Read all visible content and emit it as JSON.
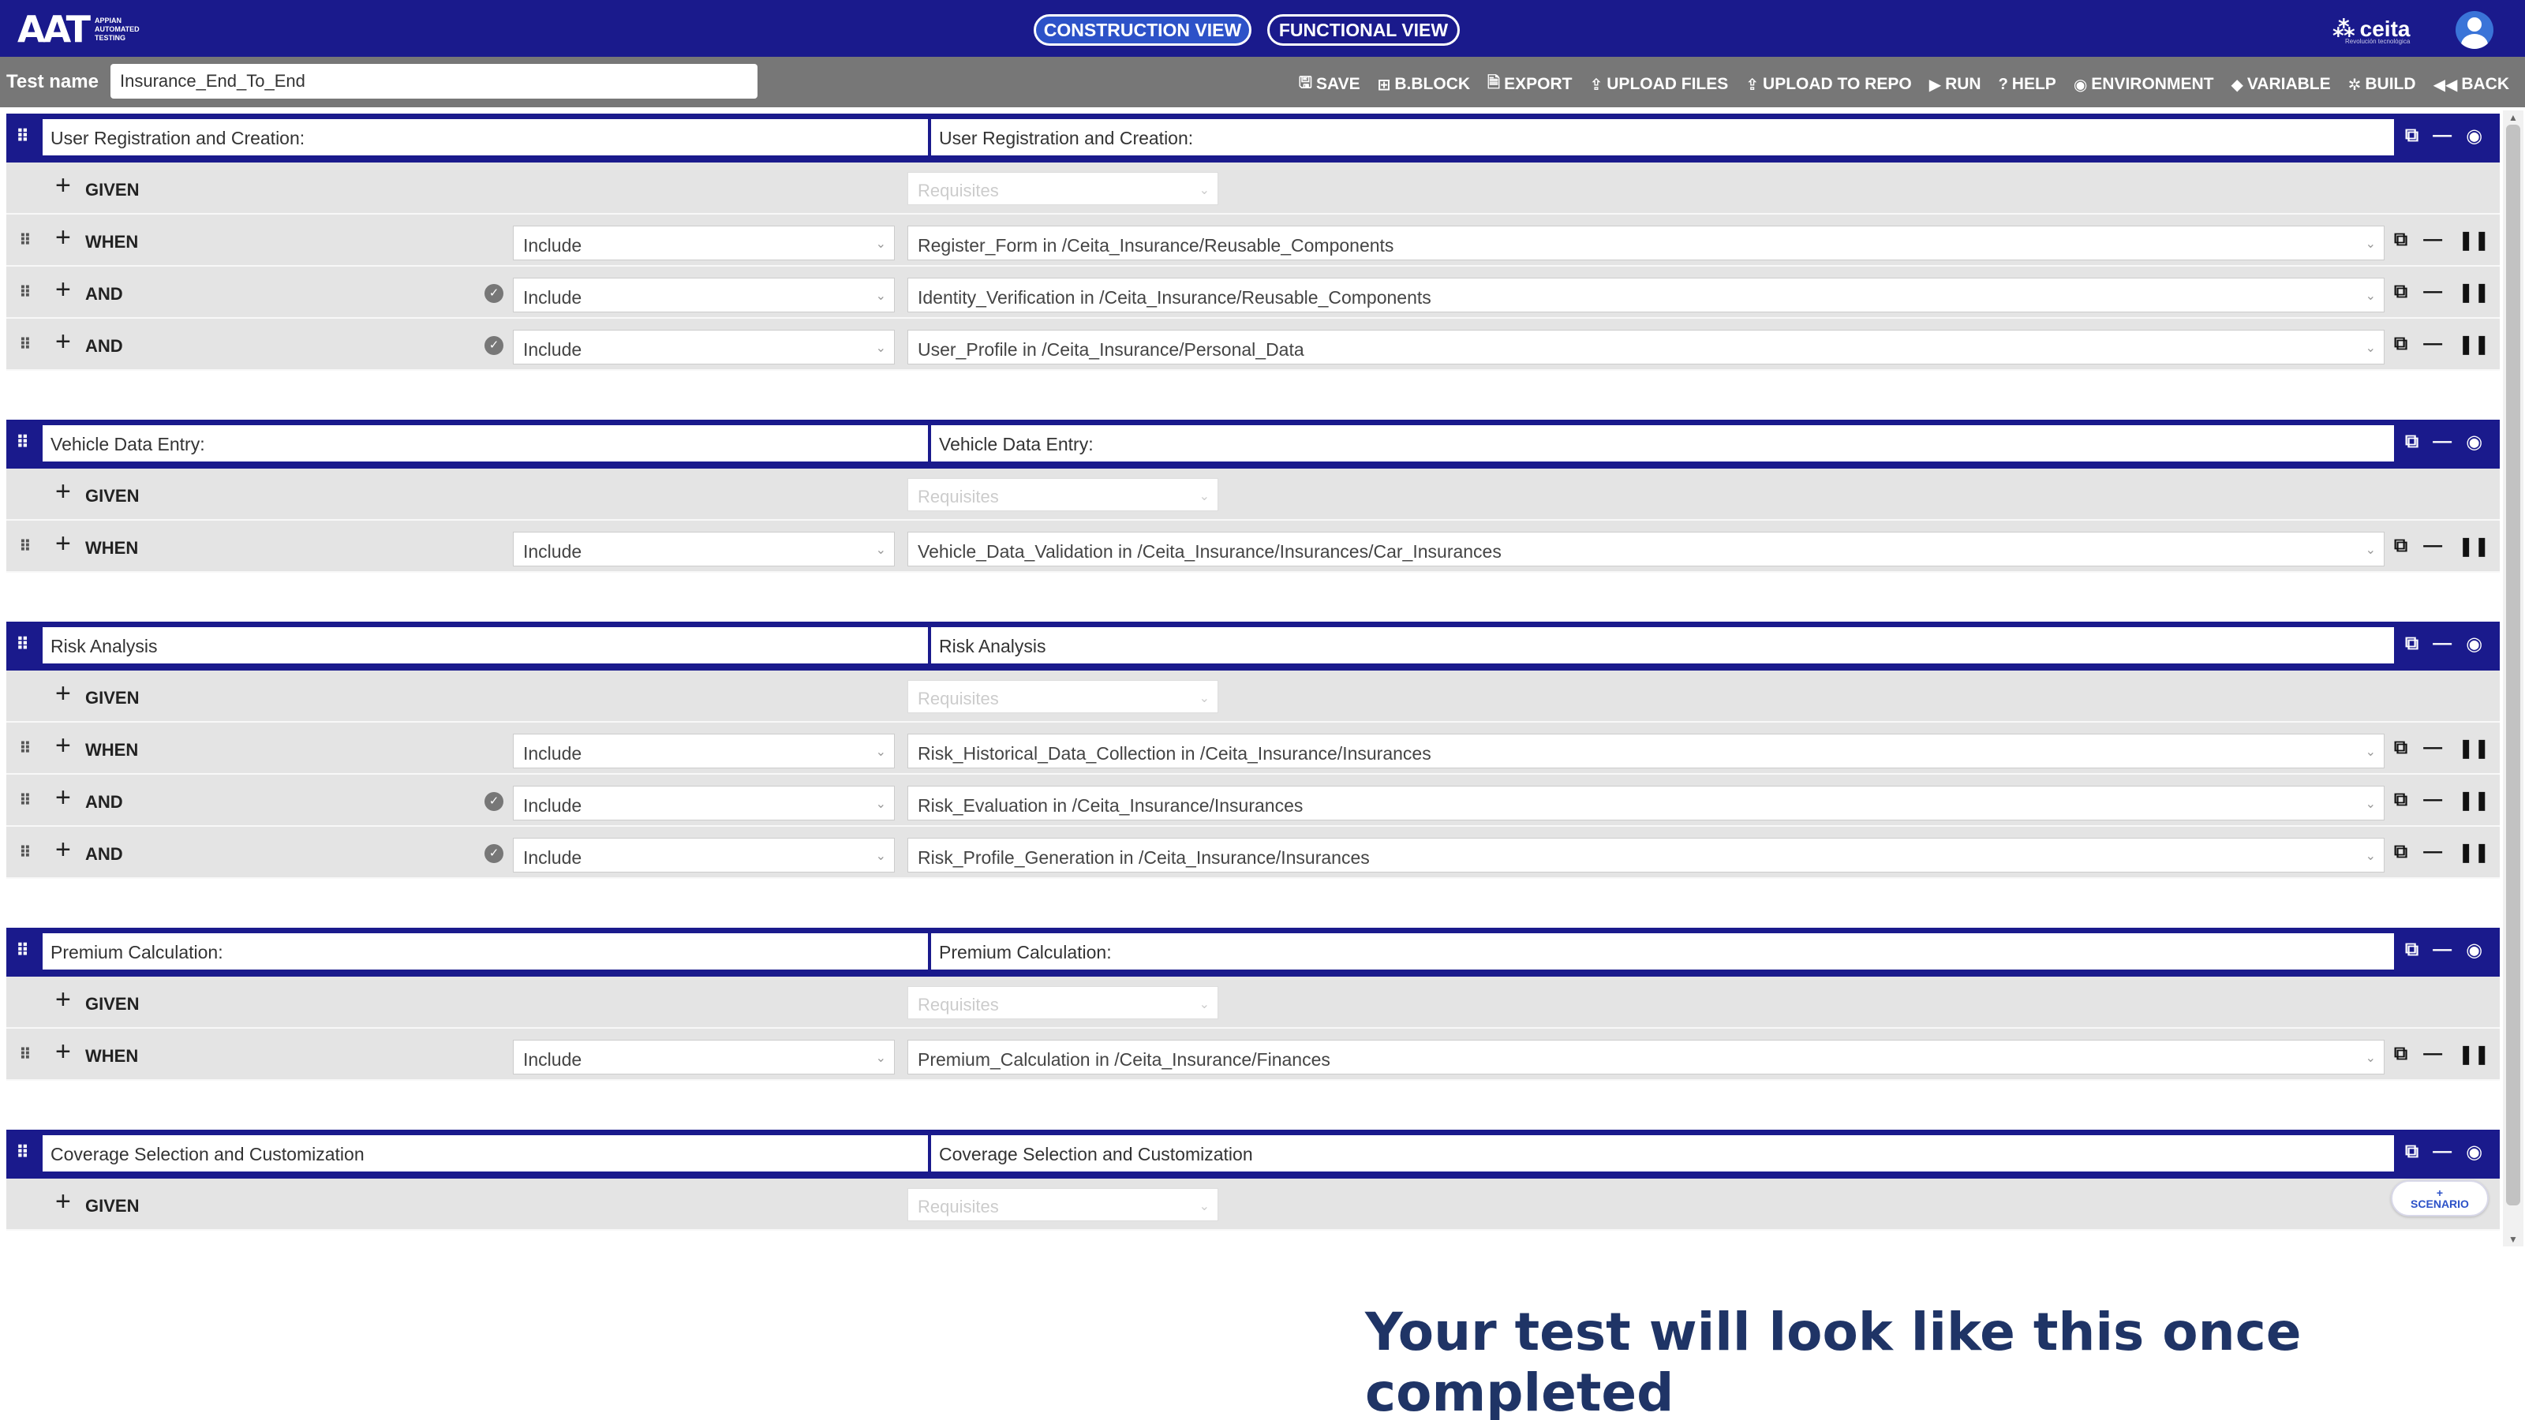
{
  "app": {
    "logo_text": "AAT",
    "logo_subtitle": "APPIAN AUTOMATED TESTING",
    "brand": "ceita",
    "brand_tagline": "Revolución tecnológica"
  },
  "views": {
    "construction": "CONSTRUCTION VIEW",
    "functional": "FUNCTIONAL VIEW"
  },
  "toolbar": {
    "test_name_label": "Test name",
    "test_name_value": "Insurance_End_To_End",
    "actions": [
      {
        "icon": "save-icon",
        "glyph": "🖫",
        "label": "SAVE"
      },
      {
        "icon": "building-block-icon",
        "glyph": "⊞",
        "label": "B.BLOCK"
      },
      {
        "icon": "document-icon",
        "glyph": "🗎",
        "label": "EXPORT"
      },
      {
        "icon": "upload-icon",
        "glyph": "⇪",
        "label": "UPLOAD FILES"
      },
      {
        "icon": "upload-icon",
        "glyph": "⇪",
        "label": "UPLOAD TO REPO"
      },
      {
        "icon": "play-icon",
        "glyph": "▶",
        "label": "RUN"
      },
      {
        "icon": "help-icon",
        "glyph": "?",
        "label": "HELP"
      },
      {
        "icon": "eye-icon",
        "glyph": "◉",
        "label": "ENVIRONMENT"
      },
      {
        "icon": "tag-icon",
        "glyph": "◆",
        "label": "VARIABLE"
      },
      {
        "icon": "gear-icon",
        "glyph": "✲",
        "label": "BUILD"
      },
      {
        "icon": "back-icon",
        "glyph": "◀◀",
        "label": "BACK"
      }
    ]
  },
  "scenarios": [
    {
      "title": "User Registration and Creation:",
      "functional_title": "User Registration and Creation:",
      "given": {
        "keyword": "GIVEN",
        "placeholder": "Requisites"
      },
      "steps": [
        {
          "keyword": "WHEN",
          "mode": "Include",
          "target": "Register_Form in /Ceita_Insurance/Reusable_Components",
          "checked": false
        },
        {
          "keyword": "AND",
          "mode": "Include",
          "target": "Identity_Verification in /Ceita_Insurance/Reusable_Components",
          "checked": true
        },
        {
          "keyword": "AND",
          "mode": "Include",
          "target": "User_Profile in /Ceita_Insurance/Personal_Data",
          "checked": true
        }
      ]
    },
    {
      "title": "Vehicle Data Entry:",
      "functional_title": "Vehicle Data Entry:",
      "given": {
        "keyword": "GIVEN",
        "placeholder": "Requisites"
      },
      "steps": [
        {
          "keyword": "WHEN",
          "mode": "Include",
          "target": "Vehicle_Data_Validation in /Ceita_Insurance/Insurances/Car_Insurances",
          "checked": false
        }
      ]
    },
    {
      "title": "Risk Analysis",
      "functional_title": "Risk Analysis",
      "given": {
        "keyword": "GIVEN",
        "placeholder": "Requisites"
      },
      "steps": [
        {
          "keyword": "WHEN",
          "mode": "Include",
          "target": "Risk_Historical_Data_Collection in /Ceita_Insurance/Insurances",
          "checked": false
        },
        {
          "keyword": "AND",
          "mode": "Include",
          "target": "Risk_Evaluation in /Ceita_Insurance/Insurances",
          "checked": true
        },
        {
          "keyword": "AND",
          "mode": "Include",
          "target": "Risk_Profile_Generation in /Ceita_Insurance/Insurances",
          "checked": true
        }
      ]
    },
    {
      "title": "Premium Calculation:",
      "functional_title": "Premium Calculation:",
      "given": {
        "keyword": "GIVEN",
        "placeholder": "Requisites"
      },
      "steps": [
        {
          "keyword": "WHEN",
          "mode": "Include",
          "target": "Premium_Calculation in /Ceita_Insurance/Finances",
          "checked": false
        }
      ]
    },
    {
      "title": "Coverage Selection and Customization",
      "functional_title": "Coverage Selection and Customization",
      "given": {
        "keyword": "GIVEN",
        "placeholder": "Requisites"
      },
      "steps": []
    }
  ],
  "add_scenario": {
    "plus": "+",
    "label": "SCENARIO"
  },
  "caption": "Your test will look like this once completed",
  "colors": {
    "primary": "#1a1a8c",
    "toolbar": "#777777",
    "row_bg": "#e4e4e4",
    "caption": "#1f3466"
  }
}
